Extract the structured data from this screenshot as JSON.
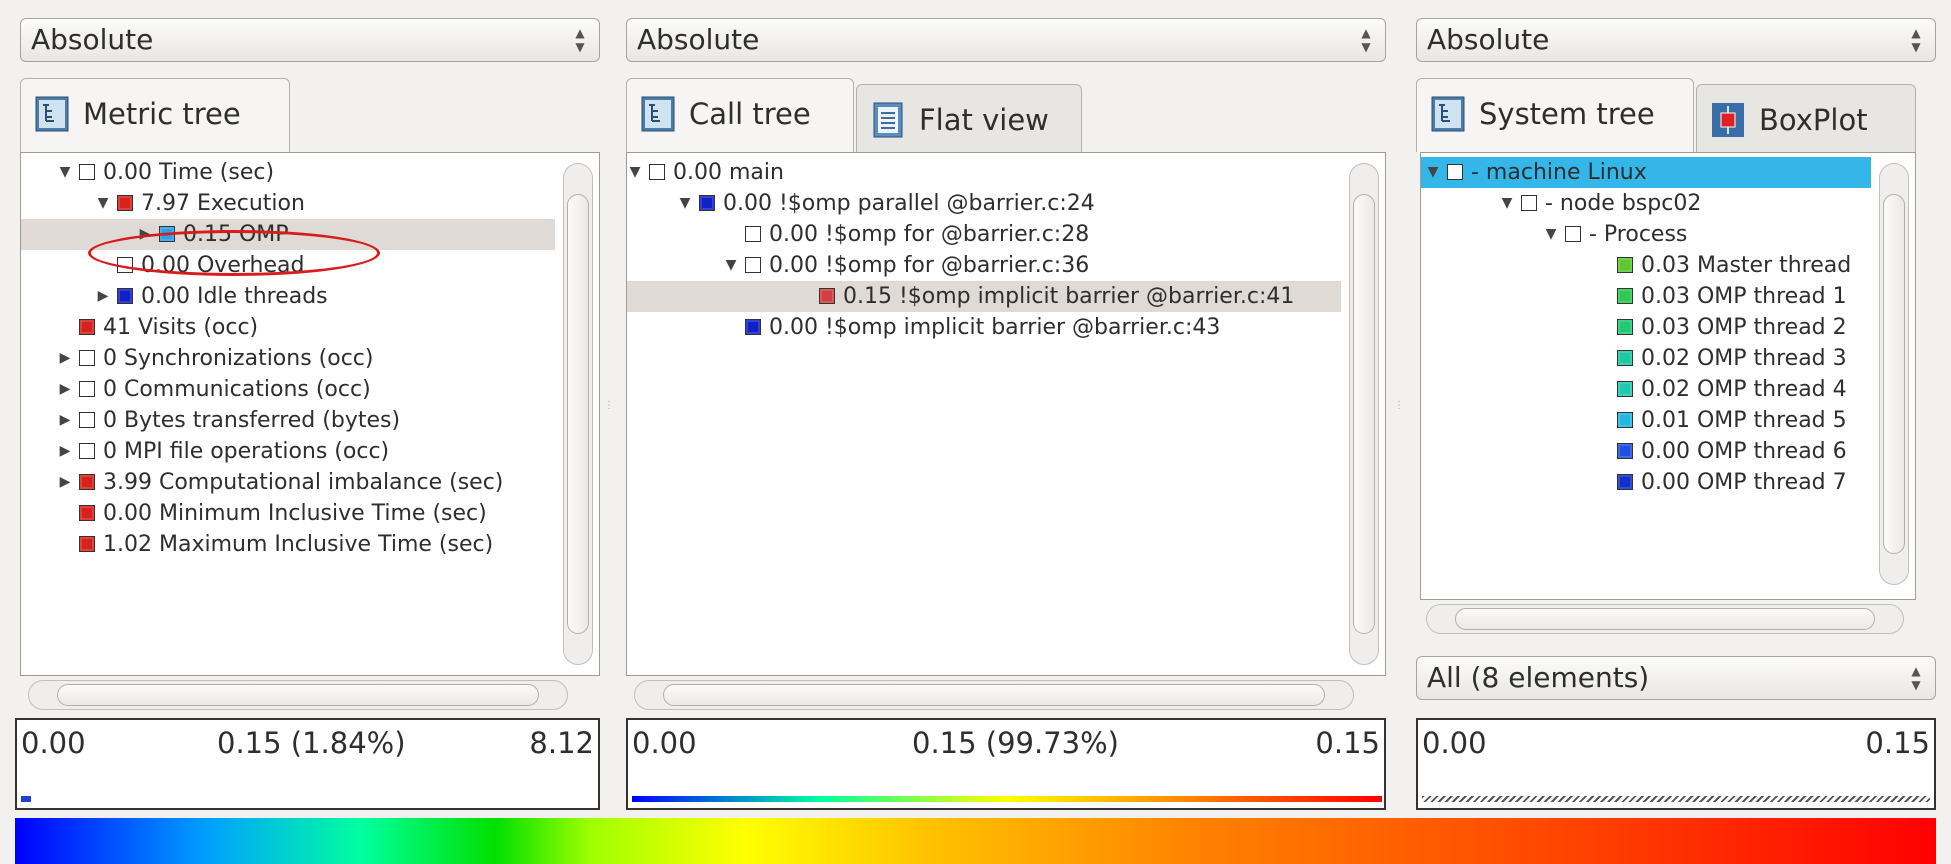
{
  "combos": {
    "metric": "Absolute",
    "call": "Absolute",
    "system": "Absolute",
    "system_filter": "All (8 elements)"
  },
  "tabs": {
    "metric_tree": "Metric tree",
    "call_tree": "Call tree",
    "flat_view": "Flat view",
    "system_tree": "System tree",
    "boxplot": "BoxPlot"
  },
  "metric_tree": [
    {
      "label": "0.00 Time (sec)",
      "expander": "down",
      "color": "none"
    },
    {
      "label": "7.97 Execution",
      "expander": "down",
      "color": "#d8211c"
    },
    {
      "label": "0.15 OMP",
      "expander": "right",
      "color": "#2aa0e8"
    },
    {
      "label": "0.00 Overhead",
      "expander": "",
      "color": "none"
    },
    {
      "label": "0.00 Idle threads",
      "expander": "right",
      "color": "#1021c8"
    },
    {
      "label": "41 Visits (occ)",
      "expander": "",
      "color": "#d8211c"
    },
    {
      "label": "0 Synchronizations (occ)",
      "expander": "right",
      "color": "none"
    },
    {
      "label": "0 Communications (occ)",
      "expander": "right",
      "color": "none"
    },
    {
      "label": "0 Bytes transferred (bytes)",
      "expander": "right",
      "color": "none"
    },
    {
      "label": "0 MPI file operations (occ)",
      "expander": "right",
      "color": "none"
    },
    {
      "label": "3.99 Computational imbalance (sec)",
      "expander": "right",
      "color": "#d8211c"
    },
    {
      "label": "0.00 Minimum Inclusive Time (sec)",
      "expander": "",
      "color": "#d8211c"
    },
    {
      "label": "1.02 Maximum Inclusive Time (sec)",
      "expander": "",
      "color": "#d8211c"
    }
  ],
  "call_tree": [
    {
      "label": "0.00 main",
      "expander": "down",
      "color": "none"
    },
    {
      "label": "0.00 !$omp parallel @barrier.c:24",
      "expander": "down",
      "color": "#1021c8"
    },
    {
      "label": "0.00 !$omp for @barrier.c:28",
      "expander": "",
      "color": "none"
    },
    {
      "label": "0.00 !$omp for @barrier.c:36",
      "expander": "down",
      "color": "none"
    },
    {
      "label": "0.15 !$omp implicit barrier @barrier.c:41",
      "expander": "",
      "color": "#d04040"
    },
    {
      "label": "0.00 !$omp implicit barrier @barrier.c:43",
      "expander": "",
      "color": "#1021c8"
    }
  ],
  "system_tree": [
    {
      "label": "- machine Linux",
      "expander": "down",
      "color": "none"
    },
    {
      "label": "- node bspc02",
      "expander": "down",
      "color": "none"
    },
    {
      "label": "- Process",
      "expander": "down",
      "color": "none"
    },
    {
      "label": "0.03 Master thread",
      "expander": "",
      "color": "#5cc830"
    },
    {
      "label": "0.03 OMP thread 1",
      "expander": "",
      "color": "#30c850"
    },
    {
      "label": "0.03 OMP thread 2",
      "expander": "",
      "color": "#20c870"
    },
    {
      "label": "0.02 OMP thread 3",
      "expander": "",
      "color": "#20c8a0"
    },
    {
      "label": "0.02 OMP thread 4",
      "expander": "",
      "color": "#20c8b0"
    },
    {
      "label": "0.01 OMP thread 5",
      "expander": "",
      "color": "#20b8e0"
    },
    {
      "label": "0.00 OMP thread 6",
      "expander": "",
      "color": "#2050e0"
    },
    {
      "label": "0.00 OMP thread 7",
      "expander": "",
      "color": "#1030c8"
    }
  ],
  "value_bars": {
    "metric": {
      "min": "0.00",
      "mid": "0.15 (1.84%)",
      "max": "8.12",
      "fill_fraction": 0.018
    },
    "call": {
      "min": "0.00",
      "mid": "0.15 (99.73%)",
      "max": "0.15",
      "fill_fraction": 0.997
    },
    "system": {
      "min": "0.00",
      "max": "0.15"
    }
  },
  "colors": {
    "selection_highlight": "#34b7e8",
    "selected_row": "#dfdad6",
    "annotation_ellipse": "#d81b1b"
  }
}
